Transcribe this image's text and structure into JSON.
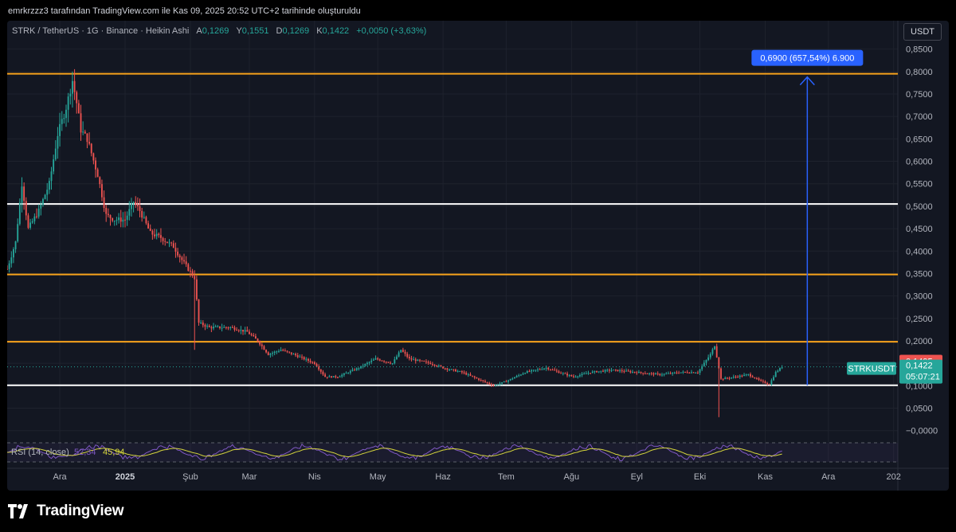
{
  "header": {
    "attribution": "emrkrzzz3 tarafından TradingView.com ile Kas 09, 2025 20:52 UTC+2 tarihinde oluşturuldu"
  },
  "legend": {
    "symbol": "STRK / TetherUS · 1G · Binance · Heikin Ashi",
    "open_label": "A",
    "open": "0,1269",
    "high_label": "Y",
    "high": "0,1551",
    "low_label": "D",
    "low": "0,1269",
    "close_label": "K",
    "close": "0,1422",
    "change": "+0,0050 (+3,63%)"
  },
  "currency_button": "USDT",
  "colors": {
    "background": "#131722",
    "up": "#26a69a",
    "down": "#ef5350",
    "orange_level": "#f7a21b",
    "white_level": "#ffffff",
    "measure": "#2962ff",
    "rsi_line": "#7e57c2",
    "rsi_ma": "#d4d43c"
  },
  "chart_data": {
    "type": "candlestick",
    "symbol": "STRKUSDT",
    "ylim": [
      -0.02,
      0.86
    ],
    "y_ticks": [
      "0,8500",
      "0,8000",
      "0,7500",
      "0,7000",
      "0,6500",
      "0,6000",
      "0,5500",
      "0,5000",
      "0,4500",
      "0,4000",
      "0,3500",
      "0,3000",
      "0,2500",
      "0,2000",
      "0,1500",
      "0,1000",
      "0,0500",
      "−0,0000"
    ],
    "y_tick_values": [
      0.85,
      0.8,
      0.75,
      0.7,
      0.65,
      0.6,
      0.55,
      0.5,
      0.45,
      0.4,
      0.35,
      0.3,
      0.25,
      0.2,
      0.15,
      0.1,
      0.05,
      0.0
    ],
    "x_ticks": [
      "Ara",
      "2025",
      "Şub",
      "Mar",
      "Nis",
      "May",
      "Haz",
      "Tem",
      "Ağu",
      "Eyl",
      "Eki",
      "Kas",
      "Ara",
      "202"
    ],
    "x_tick_dates": [
      "2024-12-01",
      "2025-01-01",
      "2025-02-01",
      "2025-03-01",
      "2025-04-01",
      "2025-05-01",
      "2025-06-01",
      "2025-07-01",
      "2025-08-01",
      "2025-09-01",
      "2025-10-01",
      "2025-11-01",
      "2025-12-01",
      "2026-01-01"
    ],
    "x_range_dates": [
      "2024-11-06",
      "2026-01-03"
    ],
    "horizontal_levels": [
      {
        "value": 0.795,
        "color": "orange"
      },
      {
        "value": 0.505,
        "color": "white"
      },
      {
        "value": 0.348,
        "color": "orange"
      },
      {
        "value": 0.198,
        "color": "orange"
      },
      {
        "value": 0.101,
        "color": "white"
      }
    ],
    "price_path": [
      [
        "2024-11-06",
        0.36
      ],
      [
        "2024-11-10",
        0.42
      ],
      [
        "2024-11-13",
        0.55
      ],
      [
        "2024-11-16",
        0.45
      ],
      [
        "2024-11-21",
        0.49
      ],
      [
        "2024-11-26",
        0.55
      ],
      [
        "2024-11-30",
        0.66
      ],
      [
        "2024-12-04",
        0.72
      ],
      [
        "2024-12-07",
        0.78
      ],
      [
        "2024-12-09",
        0.73
      ],
      [
        "2024-12-11",
        0.67
      ],
      [
        "2024-12-14",
        0.65
      ],
      [
        "2024-12-19",
        0.57
      ],
      [
        "2024-12-23",
        0.48
      ],
      [
        "2024-12-27",
        0.47
      ],
      [
        "2025-01-01",
        0.47
      ],
      [
        "2025-01-05",
        0.51
      ],
      [
        "2025-01-08",
        0.49
      ],
      [
        "2025-01-13",
        0.44
      ],
      [
        "2025-01-18",
        0.43
      ],
      [
        "2025-01-24",
        0.41
      ],
      [
        "2025-01-28",
        0.38
      ],
      [
        "2025-02-03",
        0.34
      ],
      [
        "2025-02-05",
        0.24
      ],
      [
        "2025-02-10",
        0.23
      ],
      [
        "2025-02-20",
        0.23
      ],
      [
        "2025-02-28",
        0.22
      ],
      [
        "2025-03-05",
        0.2
      ],
      [
        "2025-03-10",
        0.17
      ],
      [
        "2025-03-16",
        0.18
      ],
      [
        "2025-03-22",
        0.17
      ],
      [
        "2025-04-01",
        0.15
      ],
      [
        "2025-04-06",
        0.12
      ],
      [
        "2025-04-12",
        0.12
      ],
      [
        "2025-04-22",
        0.14
      ],
      [
        "2025-04-30",
        0.16
      ],
      [
        "2025-05-08",
        0.15
      ],
      [
        "2025-05-12",
        0.18
      ],
      [
        "2025-05-16",
        0.16
      ],
      [
        "2025-05-26",
        0.15
      ],
      [
        "2025-06-01",
        0.14
      ],
      [
        "2025-06-10",
        0.13
      ],
      [
        "2025-06-20",
        0.11
      ],
      [
        "2025-06-25",
        0.1
      ],
      [
        "2025-07-01",
        0.11
      ],
      [
        "2025-07-10",
        0.13
      ],
      [
        "2025-07-20",
        0.14
      ],
      [
        "2025-07-26",
        0.13
      ],
      [
        "2025-08-02",
        0.12
      ],
      [
        "2025-08-10",
        0.13
      ],
      [
        "2025-08-20",
        0.135
      ],
      [
        "2025-09-01",
        0.13
      ],
      [
        "2025-09-12",
        0.125
      ],
      [
        "2025-09-22",
        0.13
      ],
      [
        "2025-09-30",
        0.13
      ],
      [
        "2025-10-06",
        0.17
      ],
      [
        "2025-10-08",
        0.19
      ],
      [
        "2025-10-10",
        0.14
      ],
      [
        "2025-10-11",
        0.115
      ],
      [
        "2025-10-18",
        0.12
      ],
      [
        "2025-10-24",
        0.125
      ],
      [
        "2025-10-30",
        0.11
      ],
      [
        "2025-11-03",
        0.103
      ],
      [
        "2025-11-06",
        0.13
      ],
      [
        "2025-11-09",
        0.1422
      ]
    ],
    "extreme_wicks": [
      {
        "date": "2024-12-07",
        "value": 0.8
      },
      {
        "date": "2025-02-03",
        "value": 0.18
      },
      {
        "date": "2025-10-10",
        "value": 0.03
      }
    ],
    "measure": {
      "label": "0,6900 (657,54%) 6.900",
      "date": "2025-11-21",
      "from_value": 0.101,
      "to_value": 0.795
    },
    "price_labels": {
      "last_price": {
        "value": 0.1495,
        "text": "0,1495"
      },
      "symbol_label": "STRKUSDT",
      "current": {
        "value": 0.1422,
        "text": "0,1422"
      },
      "countdown": "05:07:21"
    },
    "rsi": {
      "label": "RSI (14, close)",
      "value1": "52,34",
      "value2": "45,94"
    }
  }
}
